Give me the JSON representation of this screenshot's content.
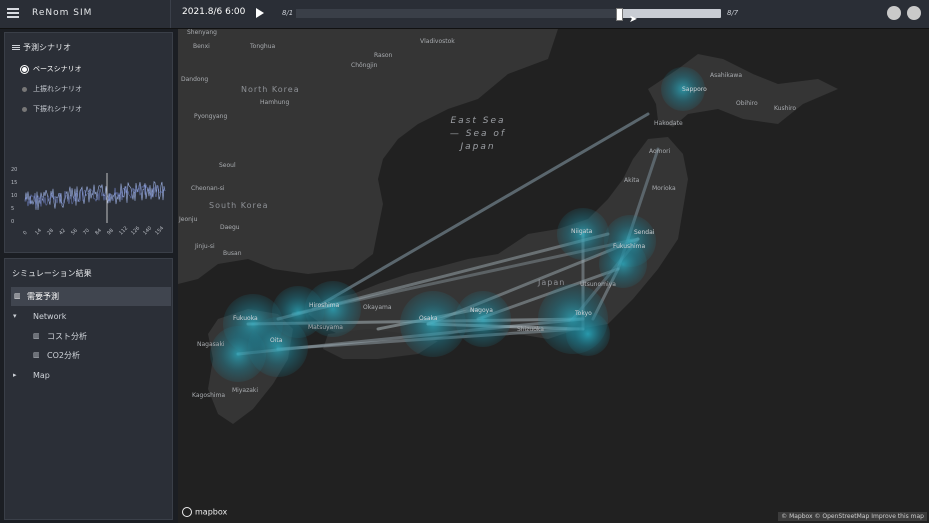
{
  "header": {
    "brand": "ReNom SIM",
    "datetime": "2021.8/6 6:00",
    "timeline_start": "8/1",
    "timeline_end": "8/7",
    "timeline_progress": 0.76
  },
  "scenario_panel": {
    "title": "予測シナリオ",
    "options": [
      {
        "label": "ベースシナリオ",
        "selected": true
      },
      {
        "label": "上振れシナリオ",
        "selected": false
      },
      {
        "label": "下振れシナリオ",
        "selected": false
      }
    ],
    "mini_chart": {
      "y_ticks": [
        "20",
        "15",
        "10",
        "5",
        "0"
      ],
      "x_ticks": [
        "0",
        "14",
        "28",
        "42",
        "56",
        "70",
        "84",
        "98",
        "112",
        "126",
        "140",
        "154"
      ]
    }
  },
  "results_panel": {
    "title": "シミュレーション結果",
    "items": [
      {
        "label": "需要予測",
        "icon": "chart-icon",
        "active": true
      },
      {
        "label": "Network",
        "icon": "caret-down-icon",
        "active": false
      },
      {
        "label": "コスト分析",
        "icon": "chart-icon",
        "active": false
      },
      {
        "label": "CO2分析",
        "icon": "chart-icon",
        "active": false
      },
      {
        "label": "Map",
        "icon": "caret-right-icon",
        "active": false
      }
    ]
  },
  "map": {
    "labels": {
      "shenyang": "Shenyang",
      "benxi": "Benxi",
      "tonghua": "Tonghua",
      "vladivostok": "Vladivostok",
      "rason": "Rason",
      "chongjin": "Chŏngjin",
      "dandong": "Dandong",
      "north_korea": "North Korea",
      "hamhung": "Hamhung",
      "pyongyang": "Pyongyang",
      "seoul": "Seoul",
      "cheonan": "Cheonan-si",
      "south_korea": "South Korea",
      "jeonju": "Jeonju",
      "daegu": "Daegu",
      "jinju": "Jinju-si",
      "busan": "Busan",
      "east_sea_1": "East Sea",
      "east_sea_2": "— Sea of",
      "east_sea_3": "Japan",
      "asahikawa": "Asahikawa",
      "sapporo": "Sapporo",
      "obihiro": "Obihiro",
      "kushiro": "Kushiro",
      "hakodate": "Hakodate",
      "aomori": "Aomori",
      "akita": "Akita",
      "morioka": "Morioka",
      "niigata": "Niigata",
      "sendai": "Sendai",
      "fukushima": "Fukushima",
      "japan": "Japan",
      "utsunomiya": "Utsunomiya",
      "tokyo": "Tokyo",
      "nagoya": "Nagoya",
      "osaka": "Osaka",
      "shizuoka": "Shizuoka",
      "okayama": "Okayama",
      "hiroshima": "Hiroshima",
      "matsuyama": "Matsuyama",
      "fukuoka": "Fukuoka",
      "oita": "Oita",
      "nagasaki": "Nagasaki",
      "miyazaki": "Miyazaki",
      "kagoshima": "Kagoshima"
    },
    "logo": "mapbox",
    "attribution": "© Mapbox © OpenStreetMap Improve this map"
  },
  "colors": {
    "accent": "#2bb3c9",
    "background": "#1b1e23",
    "panel": "#2b2f37"
  }
}
